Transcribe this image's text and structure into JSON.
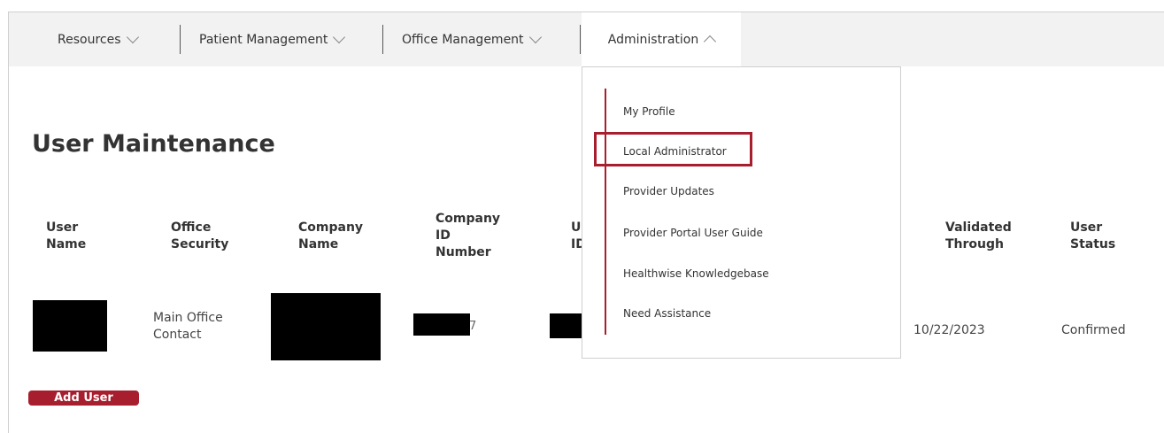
{
  "nav": {
    "items": [
      {
        "label": "Resources"
      },
      {
        "label": "Patient Management"
      },
      {
        "label": "Office Management"
      },
      {
        "label": "Administration"
      }
    ]
  },
  "page": {
    "title": "User Maintenance"
  },
  "table": {
    "headers": {
      "user_name": [
        "User",
        "Name"
      ],
      "office_security": [
        "Office",
        "Security"
      ],
      "company_name": [
        "Company",
        "Name"
      ],
      "company_id": [
        "Company",
        "ID",
        "Number"
      ],
      "user_id": [
        "U",
        "ID"
      ],
      "validated_through": [
        "Validated",
        "Through"
      ],
      "user_status": [
        "User",
        "Status"
      ]
    },
    "row": {
      "office_security": [
        "Main Office",
        "Contact"
      ],
      "company_id_tail": "7",
      "validated_through": "10/22/2023",
      "user_status": "Confirmed"
    }
  },
  "actions": {
    "add_user_label": "Add User"
  },
  "dropdown": {
    "items": [
      {
        "label": "My Profile"
      },
      {
        "label": "Local Administrator"
      },
      {
        "label": "Provider Updates"
      },
      {
        "label": "Provider Portal User Guide"
      },
      {
        "label": "Healthwise Knowledgebase"
      },
      {
        "label": "Need Assistance"
      }
    ],
    "highlighted": "Local Administrator"
  },
  "colors": {
    "accent": "#a71e2e",
    "navbar_bg": "#f2f2f2",
    "redaction": "#000000"
  },
  "icons": {
    "nav_collapsed": "chevron-down-icon",
    "nav_expanded": "chevron-up-icon"
  }
}
